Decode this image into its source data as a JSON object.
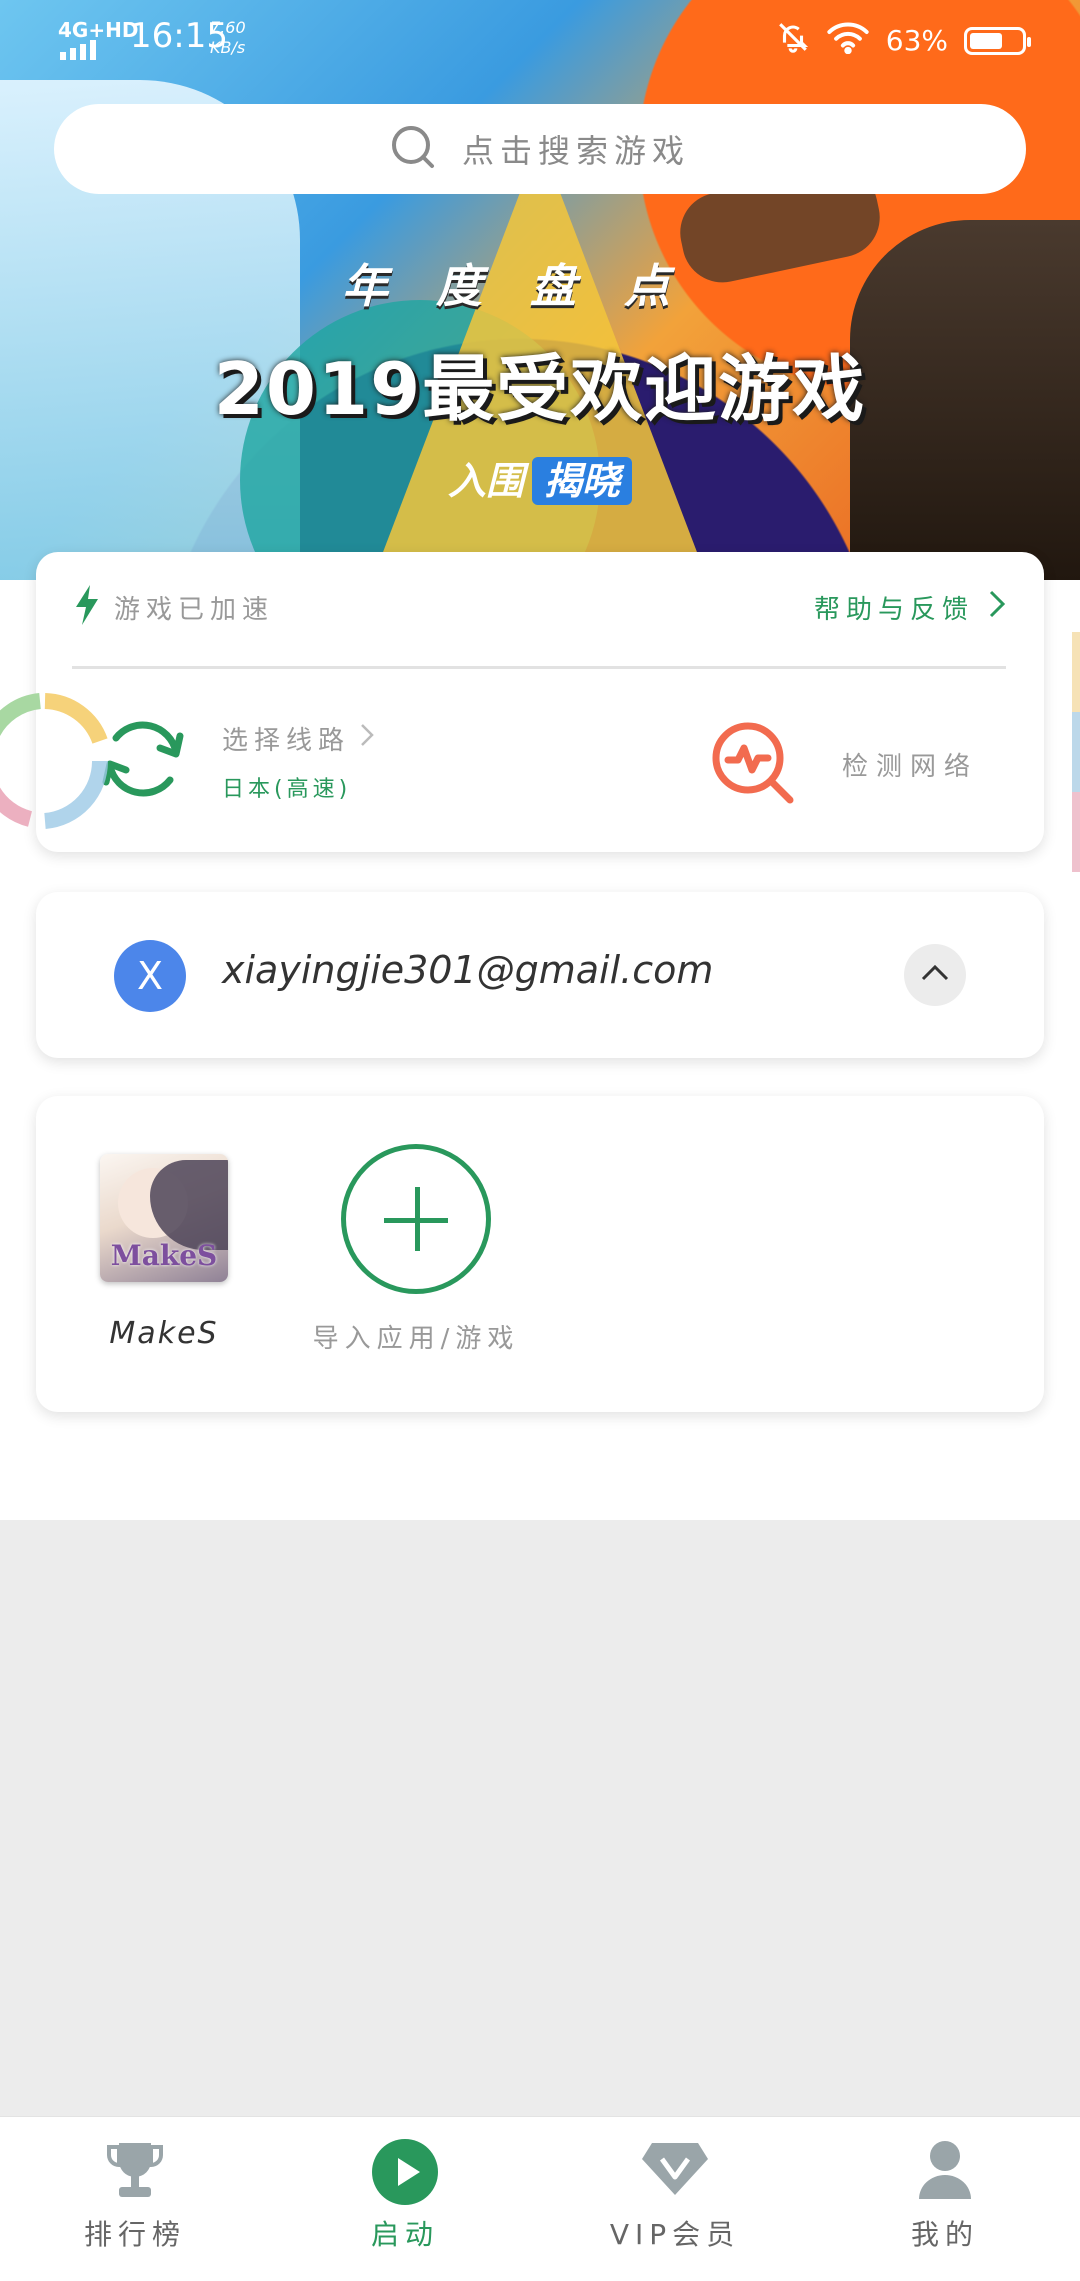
{
  "status_bar": {
    "network": "4G+HD",
    "time": "16:15",
    "speed_value": "7.60",
    "speed_unit": "KB/s",
    "battery": "63%",
    "battery_level": 0.63
  },
  "search": {
    "placeholder": "点击搜索游戏",
    "icon": "search-icon"
  },
  "banner": {
    "subtitle": "年度盘点",
    "title": "2019最受欢迎游戏",
    "tag_prefix": "入围",
    "tag_highlight": "揭晓"
  },
  "speed_card": {
    "status": "游戏已加速",
    "help_link": "帮助与反馈",
    "route_title": "选择线路",
    "route_value": "日本(高速)",
    "detect_label": "检测网络"
  },
  "account": {
    "avatar_letter": "X",
    "email": "xiayingjie301@gmail.com"
  },
  "apps": {
    "items": [
      {
        "name": "MakeS",
        "logo_text": "MakeS"
      }
    ],
    "add_label": "导入应用/游戏"
  },
  "bottom_nav": [
    {
      "label": "排行榜",
      "icon": "trophy-icon",
      "active": false
    },
    {
      "label": "启动",
      "icon": "play-icon",
      "active": true
    },
    {
      "label": "VIP会员",
      "icon": "diamond-icon",
      "active": false
    },
    {
      "label": "我的",
      "icon": "user-icon",
      "active": false
    }
  ],
  "colors": {
    "accent": "#29985c",
    "avatar": "#4c86ea",
    "detect": "#f26b4f"
  }
}
